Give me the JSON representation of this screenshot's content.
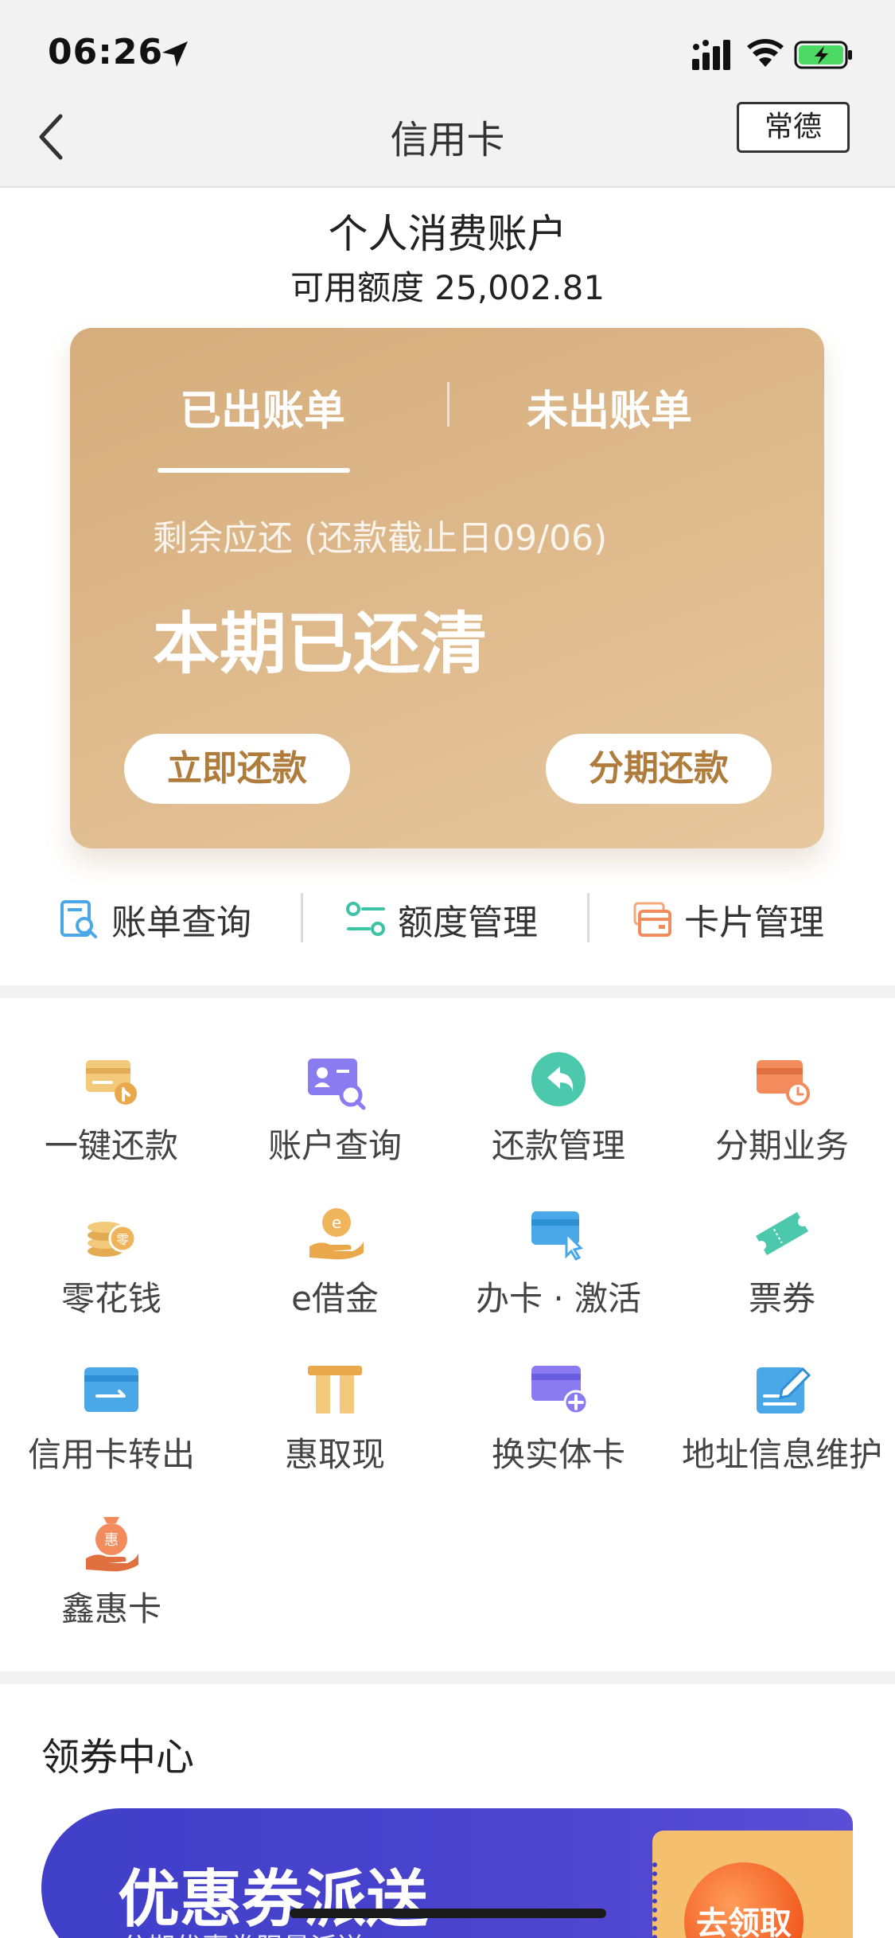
{
  "status_bar": {
    "time": "06:26"
  },
  "nav": {
    "title": "信用卡",
    "city": "常德"
  },
  "account": {
    "title": "个人消费账户",
    "limit": "可用额度 25,002.81"
  },
  "bill_card": {
    "tabs": [
      "已出账单",
      "未出账单"
    ],
    "active_tab": 0,
    "due_label": "剩余应还 (还款截止日09/06)",
    "status": "本期已还清",
    "repay_now": "立即还款",
    "installment": "分期还款"
  },
  "quick_links": [
    {
      "label": "账单查询",
      "icon": "bill-search-icon"
    },
    {
      "label": "额度管理",
      "icon": "limit-manage-icon"
    },
    {
      "label": "卡片管理",
      "icon": "card-manage-icon"
    }
  ],
  "services": [
    {
      "label": "一键还款",
      "icon": "one-click-repay-icon"
    },
    {
      "label": "账户查询",
      "icon": "account-query-icon"
    },
    {
      "label": "还款管理",
      "icon": "repay-manage-icon"
    },
    {
      "label": "分期业务",
      "icon": "installment-icon"
    },
    {
      "label": "零花钱",
      "icon": "coins-icon"
    },
    {
      "label": "e借金",
      "icon": "e-loan-icon"
    },
    {
      "label": "办卡 · 激活",
      "icon": "apply-activate-icon"
    },
    {
      "label": "票券",
      "icon": "ticket-icon"
    },
    {
      "label": "信用卡转出",
      "icon": "card-transfer-icon"
    },
    {
      "label": "惠取现",
      "icon": "cash-advance-icon"
    },
    {
      "label": "换实体卡",
      "icon": "physical-card-icon"
    },
    {
      "label": "地址信息维护",
      "icon": "address-edit-icon"
    },
    {
      "label": "鑫惠卡",
      "icon": "xinhui-card-icon"
    }
  ],
  "coupon_center": {
    "title": "领券中心",
    "banner_text": "优惠券派送",
    "banner_sub": "分期优惠券限量派送",
    "claim": "去领取"
  },
  "colors": {
    "card_gold": "#d6ad7d",
    "accent_brown": "#b07c3c",
    "banner_purple": "#4b44cf",
    "claim_orange": "#f25a1f"
  }
}
